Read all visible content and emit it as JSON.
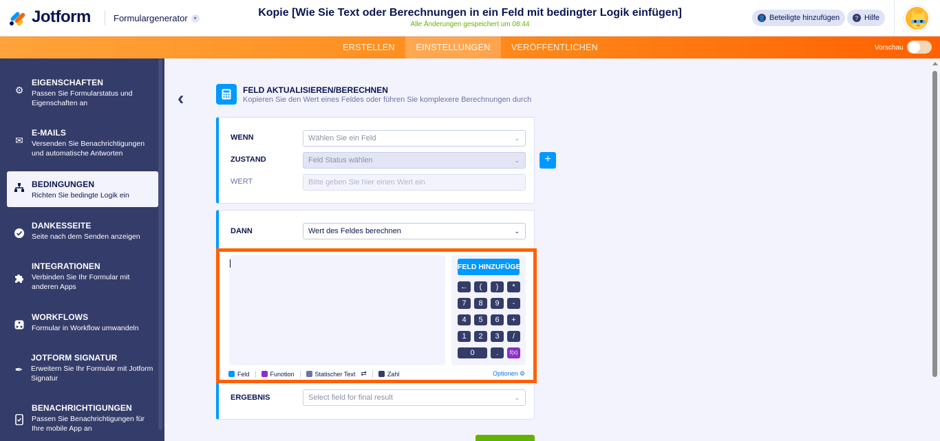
{
  "header": {
    "logo": "Jotform",
    "app_switcher": "Formulargenerator",
    "doc_title": "Kopie [Wie Sie Text oder Berechnungen in ein Feld mit bedingter Logik einfügen]",
    "saved_status": "Alle Änderungen gespeichert um 08:44",
    "invite_label": "Beteiligte hinzufügen",
    "help_label": "Hilfe"
  },
  "nav": {
    "tabs": [
      {
        "label": "ERSTELLEN",
        "active": false
      },
      {
        "label": "EINSTELLUNGEN",
        "active": true
      },
      {
        "label": "VERÖFFENTLICHEN",
        "active": false
      }
    ],
    "preview_label": "Vorschau"
  },
  "sidebar": {
    "items": [
      {
        "title": "EIGENSCHAFTEN",
        "desc": "Passen Sie Formularstatus und Eigenschaften an",
        "icon": "gear-icon"
      },
      {
        "title": "E-MAILS",
        "desc": "Versenden Sie Benachrichtigungen und automatische Antworten",
        "icon": "envelope-icon"
      },
      {
        "title": "BEDINGUNGEN",
        "desc": "Richten Sie bedingte Logik ein",
        "icon": "sitemap-icon",
        "active": true
      },
      {
        "title": "DANKESSEITE",
        "desc": "Seite nach dem Senden anzeigen",
        "icon": "check-circle-icon"
      },
      {
        "title": "INTEGRATIONEN",
        "desc": "Verbinden Sie Ihr Formular mit anderen Apps",
        "icon": "puzzle-icon"
      },
      {
        "title": "WORKFLOWS",
        "desc": "Formular in Workflow umwandeln",
        "icon": "workflow-icon"
      },
      {
        "title": "JOTFORM SIGNATUR",
        "desc": "Erweitern Sie Ihr Formular mit Jotform Signatur",
        "icon": "pen-icon"
      },
      {
        "title": "BENACHRICHTIGUNGEN",
        "desc": "Passen Sie Benachrichtigungen für Ihre mobile App an",
        "icon": "mobile-icon"
      }
    ]
  },
  "main": {
    "section_title": "FELD AKTUALISIEREN/BERECHNEN",
    "section_subtitle": "Kopieren Sie den Wert eines Feldes oder führen Sie komplexere Berechnungen durch",
    "if_card": {
      "wenn_label": "WENN",
      "wenn_placeholder": "Wählen Sie ein Feld",
      "zustand_label": "ZUSTAND",
      "zustand_placeholder": "Feld Status wählen",
      "wert_label": "WERT",
      "wert_placeholder": "Bitte geben Sie hier einen Wert ein"
    },
    "then_card": {
      "dann_label": "DANN",
      "dann_value": "Wert des Feldes berechnen",
      "add_field_label": "FELD HINZUFÜGEN",
      "keys": [
        "←",
        "(",
        ")",
        "*",
        "7",
        "8",
        "9",
        "-",
        "4",
        "5",
        "6",
        "+",
        "1",
        "2",
        "3",
        "/",
        "0",
        ".",
        "f(x)"
      ],
      "legend": [
        {
          "label": "Feld",
          "color": "#0099ff"
        },
        {
          "label": "Funotion",
          "color": "#8a2fc8"
        },
        {
          "label": "Statischer Text",
          "color": "#6c73a8"
        },
        {
          "label": "Zahl",
          "color": "#343c6a"
        }
      ],
      "options_label": "Optionen",
      "ergebnis_label": "ERGEBNIS",
      "ergebnis_placeholder": "Select field for final result"
    }
  },
  "colors": {
    "accent": "#0099ff",
    "orange": "#ff6100",
    "sidebar": "#343c6a",
    "green": "#64b200"
  }
}
